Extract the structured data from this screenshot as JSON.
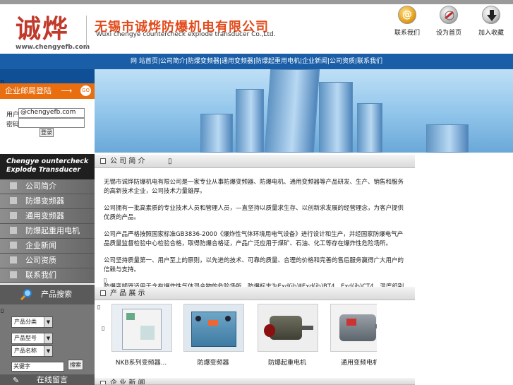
{
  "header": {
    "logo_cn": "诚烨",
    "logo_url": "www.chengyefb.com",
    "company_cn": "无锡市诚烨防爆机电有限公司",
    "company_en": "Wuxi chengye countercheck explode transducer Co.,Ltd.",
    "quick_links": [
      {
        "label": "联系我们",
        "icon": "email-at-icon",
        "color": "#e8a21a"
      },
      {
        "label": "设为首页",
        "icon": "browser-icon",
        "color": "#b9b9b9"
      },
      {
        "label": "加入收藏",
        "icon": "download-arrow-icon",
        "color": "#333333"
      }
    ]
  },
  "nav": {
    "text": "网 站首页|公司简介|防爆变频器|通用变频器|防爆起重用电机|企业新闻|公司资质|联系我们"
  },
  "login": {
    "title": "企业邮局登陆",
    "go_label": "GO",
    "user_label": "用户",
    "user_value": "@chengyefb.com",
    "pass_label": "密码",
    "pass_value": "",
    "submit_label": "登录"
  },
  "sidebar": {
    "title_line1": "Chengye ountercheck",
    "title_line2": "Explode Transducer",
    "menu": [
      {
        "label": "公司简介"
      },
      {
        "label": "防爆变频器"
      },
      {
        "label": "通用变频器"
      },
      {
        "label": "防爆起重用电机"
      },
      {
        "label": "企业新闻"
      },
      {
        "label": "公司资质"
      },
      {
        "label": "联系我们"
      }
    ]
  },
  "search": {
    "title": "产品搜索",
    "select1": "产品分类",
    "select2": "产品型号",
    "select3": "产品名称",
    "keyword_value": "关键字",
    "button_label": "搜索"
  },
  "guestbook": {
    "label": "在线留言"
  },
  "about_section": {
    "title": "公 司 简 介",
    "paragraphs": [
      "无锡市诚烨防爆机电有限公司是一家专业从事防爆变频器、防爆电机、通用变频器等产品研发、生产、销售和服务的高新技术企业，公司技术力量雄厚。",
      "公司拥有一批高素质的专业技术人员和管理人员，—直坚持以质量求生存、以创新求发展的经营理念，为客户提供优质的产品。",
      "公司产品严格按照国家标准GB3836-2000《爆炸性气体环境用电气设备》进行设计和生产，并经国家防爆电气产品质量监督检验中心检验合格，取得防爆合格证，产品广泛应用于煤矿、石油、化工等存在爆炸性危险场所。",
      "公司坚持质量第一、用户至上的原则，以先进的技术、可靠的质量、合理的价格和完善的售后服务赢得广大用户的信赖与支持。",
      "防爆变频器适用于含有爆炸性气体混合物的危险场所，防爆标志为Exd(ib)ⅡExd(ib)BT4、Exd(ib)CT4，温度组别为T1~T4，适用于煤矿井下及石油化工等行业的电机调速控制，节能效果显著，运行安全可靠。"
    ]
  },
  "products_section": {
    "title": "产 品 展 示",
    "items": [
      {
        "label": "NKB系列变频器..."
      },
      {
        "label": "防爆变频器"
      },
      {
        "label": "防爆起重电机"
      },
      {
        "label": "通用变频电机"
      }
    ]
  },
  "bottom_section": {
    "title": "企 业 新 闻"
  },
  "colors": {
    "nav_blue": "#1a5ea8",
    "login_orange": "#e86e10",
    "company_red": "#e14a1b",
    "logo_red": "#c0392b"
  }
}
